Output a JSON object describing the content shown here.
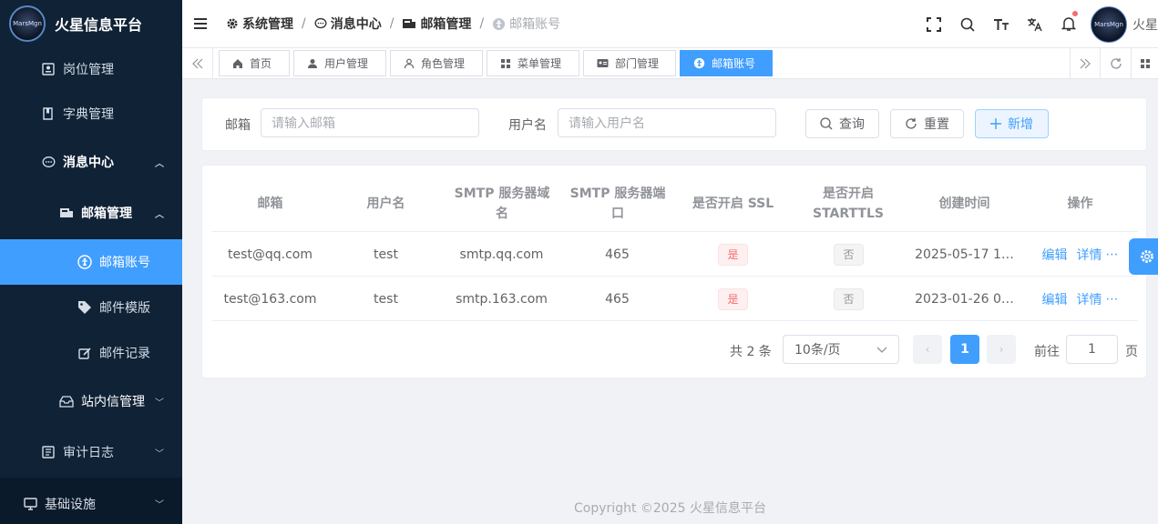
{
  "app": {
    "title": "火星信息平台",
    "logo_text": "MarsMgn"
  },
  "sidebar": {
    "items": [
      {
        "label": "岗位管理",
        "icon": "post-icon"
      },
      {
        "label": "字典管理",
        "icon": "book-icon"
      },
      {
        "label": "消息中心",
        "icon": "chat-icon",
        "expanded": true
      },
      {
        "label": "邮箱管理",
        "icon": "mailbox-icon",
        "expanded": true
      },
      {
        "label": "邮箱账号",
        "icon": "account-icon",
        "active": true
      },
      {
        "label": "邮件模版",
        "icon": "tag-icon"
      },
      {
        "label": "邮件记录",
        "icon": "edit-icon"
      },
      {
        "label": "站内信管理",
        "icon": "inbox-icon"
      },
      {
        "label": "审计日志",
        "icon": "log-icon"
      },
      {
        "label": "基础设施",
        "icon": "monitor-icon"
      }
    ]
  },
  "breadcrumb": [
    "系统管理",
    "消息中心",
    "邮箱管理",
    "邮箱账号"
  ],
  "header": {
    "username": "火星"
  },
  "tabs": [
    "首页",
    "用户管理",
    "角色管理",
    "菜单管理",
    "部门管理",
    "邮箱账号"
  ],
  "search": {
    "mail_label": "邮箱",
    "mail_placeholder": "请输入邮箱",
    "user_label": "用户名",
    "user_placeholder": "请输入用户名",
    "query": "查询",
    "reset": "重置",
    "add": "新增"
  },
  "table": {
    "headers": [
      "邮箱",
      "用户名",
      "SMTP 服务器域名",
      "SMTP 服务器端口",
      "是否开启 SSL",
      "是否开启 STARTTLS",
      "创建时间",
      "操作"
    ],
    "rows": [
      {
        "mail": "test@qq.com",
        "username": "test",
        "host": "smtp.qq.com",
        "port": "465",
        "ssl": "是",
        "starttls": "否",
        "created": "2025-05-17 1…",
        "edit": "编辑",
        "detail": "详情",
        "more": "⋯"
      },
      {
        "mail": "test@163.com",
        "username": "test",
        "host": "smtp.163.com",
        "port": "465",
        "ssl": "是",
        "starttls": "否",
        "created": "2023-01-26 0…",
        "edit": "编辑",
        "detail": "详情",
        "more": "⋯"
      }
    ]
  },
  "pagination": {
    "total": "共 2 条",
    "page_size": "10条/页",
    "current": "1",
    "goto": "前往",
    "goto_value": "1",
    "page_unit": "页"
  },
  "footer": "Copyright ©2025 火星信息平台",
  "colors": {
    "primary": "#409eff",
    "sidebar_bg": "#0f2236"
  }
}
